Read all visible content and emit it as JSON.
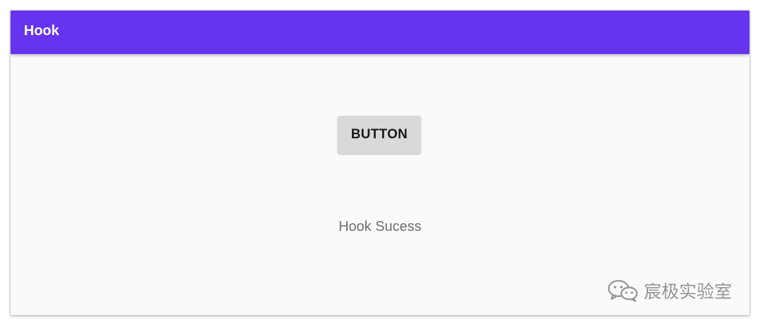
{
  "app": {
    "title": "Hook",
    "accent_color": "#6633ee"
  },
  "main": {
    "button_label": "BUTTON",
    "status_text": "Hook Sucess"
  },
  "watermark": {
    "icon": "wechat-icon",
    "text": "宸极实验室"
  }
}
